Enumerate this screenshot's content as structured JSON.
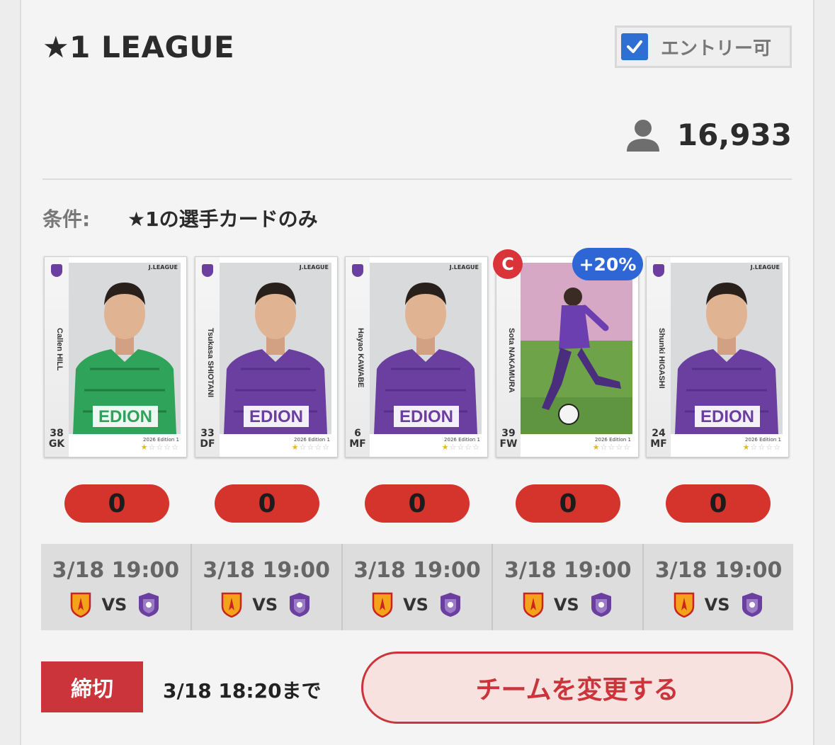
{
  "header": {
    "title": "★1 LEAGUE",
    "entry_label": "エントリー可",
    "entry_checked": true
  },
  "participants": {
    "count": "16,933",
    "icon": "person-icon"
  },
  "condition": {
    "label": "条件:",
    "value": "★1の選手カードのみ"
  },
  "card_common": {
    "brand": "J.LEAGUE",
    "edition": "2026 Edition 1",
    "stars_on": "★",
    "stars_off": "☆☆☆☆"
  },
  "cards": [
    {
      "name": "Callen HILL",
      "number": "38",
      "position": "GK",
      "kit": "green",
      "score": "0"
    },
    {
      "name": "Tsukasa SHIOTANI",
      "number": "33",
      "position": "DF",
      "kit": "purple",
      "score": "0"
    },
    {
      "name": "Hayao KAWABE",
      "number": "6",
      "position": "MF",
      "kit": "purple",
      "score": "0"
    },
    {
      "name": "Sota NAKAMURA",
      "number": "39",
      "position": "FW",
      "kit": "action",
      "score": "0",
      "captain": "C",
      "bonus": "+20%"
    },
    {
      "name": "Shunki HIGASHI",
      "number": "24",
      "position": "MF",
      "kit": "purple",
      "score": "0"
    }
  ],
  "matches": [
    {
      "time": "3/18 19:00",
      "vs": "VS",
      "home_icon": "nagoya-crest-icon",
      "away_icon": "hiroshima-crest-icon"
    },
    {
      "time": "3/18 19:00",
      "vs": "VS",
      "home_icon": "nagoya-crest-icon",
      "away_icon": "hiroshima-crest-icon"
    },
    {
      "time": "3/18 19:00",
      "vs": "VS",
      "home_icon": "nagoya-crest-icon",
      "away_icon": "hiroshima-crest-icon"
    },
    {
      "time": "3/18 19:00",
      "vs": "VS",
      "home_icon": "nagoya-crest-icon",
      "away_icon": "hiroshima-crest-icon"
    },
    {
      "time": "3/18 19:00",
      "vs": "VS",
      "home_icon": "nagoya-crest-icon",
      "away_icon": "hiroshima-crest-icon"
    }
  ],
  "deadline": {
    "tag": "締切",
    "text": "3/18 18:20まで"
  },
  "action": {
    "change_team_label": "チームを変更する"
  },
  "colors": {
    "accent_red": "#cc343c",
    "score_red": "#d5342d",
    "checkbox_blue": "#2f6fd4",
    "bonus_blue": "#2f66d6",
    "sanfrecce_purple": "#6a3fa0",
    "gk_green": "#2fa35a"
  }
}
